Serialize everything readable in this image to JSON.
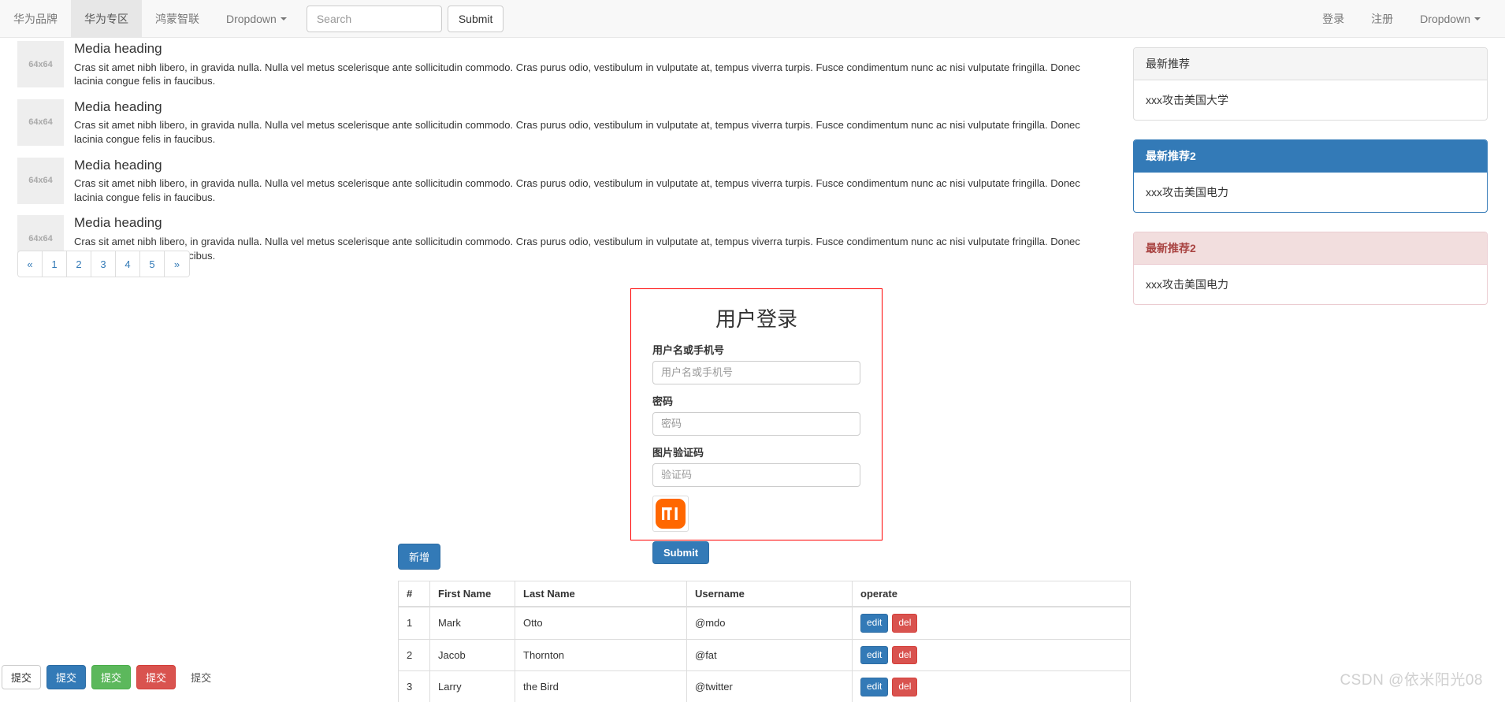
{
  "navbar": {
    "left_items": [
      {
        "label": "华为品牌",
        "active": false,
        "dropdown": false
      },
      {
        "label": "华为专区",
        "active": true,
        "dropdown": false
      },
      {
        "label": "鸿蒙智联",
        "active": false,
        "dropdown": false
      },
      {
        "label": "Dropdown",
        "active": false,
        "dropdown": true
      }
    ],
    "search": {
      "placeholder": "Search",
      "value": ""
    },
    "submit_label": "Submit",
    "right_items": [
      {
        "label": "登录",
        "dropdown": false
      },
      {
        "label": "注册",
        "dropdown": false
      },
      {
        "label": "Dropdown",
        "dropdown": true
      }
    ]
  },
  "media_list": [
    {
      "thumb": "64x64",
      "heading": "Media heading",
      "text": "Cras sit amet nibh libero, in gravida nulla. Nulla vel metus scelerisque ante sollicitudin commodo. Cras purus odio, vestibulum in vulputate at, tempus viverra turpis. Fusce condimentum nunc ac nisi vulputate fringilla. Donec lacinia congue felis in faucibus."
    },
    {
      "thumb": "64x64",
      "heading": "Media heading",
      "text": "Cras sit amet nibh libero, in gravida nulla. Nulla vel metus scelerisque ante sollicitudin commodo. Cras purus odio, vestibulum in vulputate at, tempus viverra turpis. Fusce condimentum nunc ac nisi vulputate fringilla. Donec lacinia congue felis in faucibus."
    },
    {
      "thumb": "64x64",
      "heading": "Media heading",
      "text": "Cras sit amet nibh libero, in gravida nulla. Nulla vel metus scelerisque ante sollicitudin commodo. Cras purus odio, vestibulum in vulputate at, tempus viverra turpis. Fusce condimentum nunc ac nisi vulputate fringilla. Donec lacinia congue felis in faucibus."
    },
    {
      "thumb": "64x64",
      "heading": "Media heading",
      "text": "Cras sit amet nibh libero, in gravida nulla. Nulla vel metus scelerisque ante sollicitudin commodo. Cras purus odio, vestibulum in vulputate at, tempus viverra turpis. Fusce condimentum nunc ac nisi vulputate fringilla. Donec lacinia congue felis in faucibus."
    }
  ],
  "pagination": [
    "«",
    "1",
    "2",
    "3",
    "4",
    "5",
    "»"
  ],
  "panels": [
    {
      "style": "default",
      "heading": "最新推荐",
      "body": "xxx攻击美国大学"
    },
    {
      "style": "primary",
      "heading": "最新推荐2",
      "body": "xxx攻击美国电力"
    },
    {
      "style": "danger",
      "heading": "最新推荐2",
      "body": "xxx攻击美国电力"
    }
  ],
  "login": {
    "title": "用户登录",
    "username_label": "用户名或手机号",
    "username_placeholder": "用户名或手机号",
    "username_value": "",
    "password_label": "密码",
    "password_placeholder": "密码",
    "password_value": "",
    "captcha_label": "图片验证码",
    "captcha_placeholder": "验证码",
    "captcha_value": "",
    "captcha_image_alt": "mi-logo",
    "submit_label": "Submit",
    "border_color": "#ff0000"
  },
  "table_section": {
    "add_label": "新增",
    "headers": [
      "#",
      "First Name",
      "Last Name",
      "Username",
      "operate"
    ],
    "rows": [
      {
        "id": "1",
        "first": "Mark",
        "last": "Otto",
        "username": "@mdo",
        "edit": "edit",
        "del": "del"
      },
      {
        "id": "2",
        "first": "Jacob",
        "last": "Thornton",
        "username": "@fat",
        "edit": "edit",
        "del": "del"
      },
      {
        "id": "3",
        "first": "Larry",
        "last": "the Bird",
        "username": "@twitter",
        "edit": "edit",
        "del": "del"
      }
    ]
  },
  "bottom_buttons": [
    {
      "label": "提交",
      "style": "default"
    },
    {
      "label": "提交",
      "style": "primary"
    },
    {
      "label": "提交",
      "style": "success"
    },
    {
      "label": "提交",
      "style": "danger"
    },
    {
      "label": "提交",
      "style": "link"
    }
  ],
  "watermark": "CSDN @依米阳光08",
  "colors": {
    "primary": "#337ab7",
    "success": "#5cb85c",
    "danger": "#d9534f",
    "navbar_bg": "#f8f8f8",
    "mi_orange": "#ff6700"
  }
}
